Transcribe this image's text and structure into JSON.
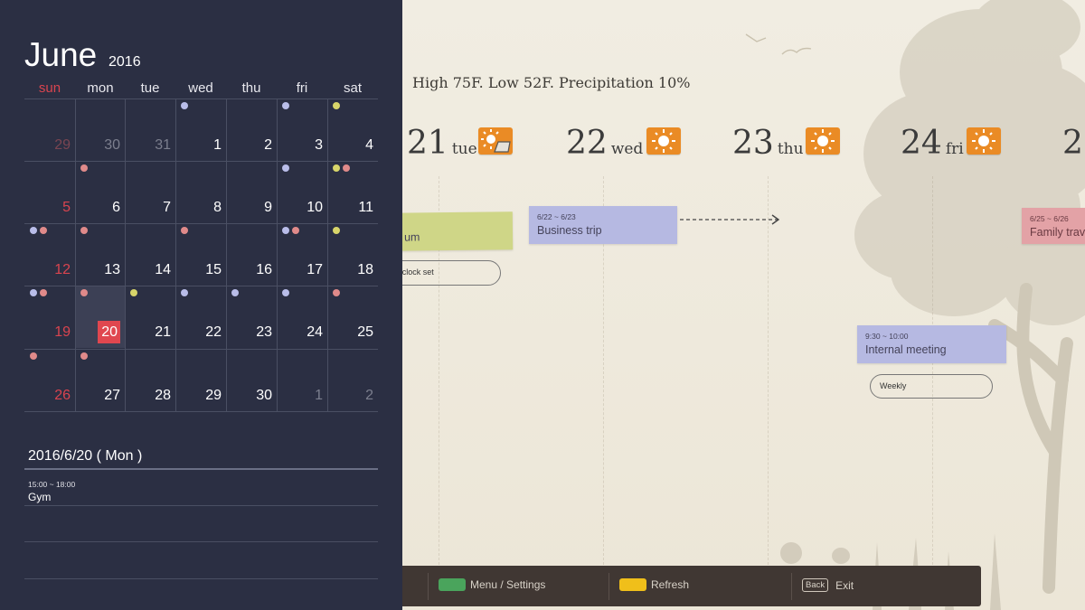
{
  "calendar": {
    "month": "June",
    "year": "2016",
    "weekdays": [
      "sun",
      "mon",
      "tue",
      "wed",
      "thu",
      "fri",
      "sat"
    ],
    "weeks": [
      [
        {
          "d": "29",
          "c": "dimred"
        },
        {
          "d": "30",
          "c": "dim"
        },
        {
          "d": "31",
          "c": "dim"
        },
        {
          "d": "1",
          "c": "",
          "dots": [
            "#b9bde9"
          ]
        },
        {
          "d": "2",
          "c": ""
        },
        {
          "d": "3",
          "c": "",
          "dots": [
            "#b9bde9"
          ]
        },
        {
          "d": "4",
          "c": "",
          "dots": [
            "#d8d56a"
          ]
        }
      ],
      [
        {
          "d": "5",
          "c": "red"
        },
        {
          "d": "6",
          "c": "",
          "dots": [
            "#e08a8a"
          ]
        },
        {
          "d": "7",
          "c": ""
        },
        {
          "d": "8",
          "c": ""
        },
        {
          "d": "9",
          "c": ""
        },
        {
          "d": "10",
          "c": "",
          "dots": [
            "#b9bde9"
          ]
        },
        {
          "d": "11",
          "c": "",
          "dots": [
            "#d8d56a",
            "#e08a8a"
          ]
        }
      ],
      [
        {
          "d": "12",
          "c": "red",
          "dots": [
            "#b9bde9",
            "#e08a8a"
          ]
        },
        {
          "d": "13",
          "c": "",
          "dots": [
            "#e08a8a"
          ]
        },
        {
          "d": "14",
          "c": ""
        },
        {
          "d": "15",
          "c": "",
          "dots": [
            "#e08a8a"
          ]
        },
        {
          "d": "16",
          "c": ""
        },
        {
          "d": "17",
          "c": "",
          "dots": [
            "#b9bde9",
            "#e08a8a"
          ]
        },
        {
          "d": "18",
          "c": "",
          "dots": [
            "#d8d56a"
          ]
        }
      ],
      [
        {
          "d": "19",
          "c": "red",
          "dots": [
            "#b9bde9",
            "#e08a8a"
          ]
        },
        {
          "d": "20",
          "c": "today",
          "dots": [
            "#e08a8a"
          ]
        },
        {
          "d": "21",
          "c": "",
          "dots": [
            "#d8d56a"
          ]
        },
        {
          "d": "22",
          "c": "",
          "dots": [
            "#b9bde9"
          ]
        },
        {
          "d": "23",
          "c": "",
          "dots": [
            "#b9bde9"
          ]
        },
        {
          "d": "24",
          "c": "",
          "dots": [
            "#b9bde9"
          ]
        },
        {
          "d": "25",
          "c": "",
          "dots": [
            "#e08a8a"
          ]
        }
      ],
      [
        {
          "d": "26",
          "c": "red",
          "dots": [
            "#e08a8a"
          ]
        },
        {
          "d": "27",
          "c": "",
          "dots": [
            "#e08a8a"
          ]
        },
        {
          "d": "28",
          "c": ""
        },
        {
          "d": "29",
          "c": ""
        },
        {
          "d": "30",
          "c": ""
        },
        {
          "d": "1",
          "c": "dim"
        },
        {
          "d": "2",
          "c": "dim"
        }
      ]
    ],
    "selected_date": "2016/6/20 ( Mon )",
    "events": [
      {
        "time": "15:00 ~ 18:00",
        "name": "Gym"
      }
    ]
  },
  "weather": {
    "summary": "High 75F. Low 52F. Precipitation 10%"
  },
  "days": [
    {
      "num": "21",
      "name": "tue",
      "icon": "sun-cloud-icon"
    },
    {
      "num": "22",
      "name": "wed",
      "icon": "sun-icon"
    },
    {
      "num": "23",
      "name": "thu",
      "icon": "sun-icon"
    },
    {
      "num": "24",
      "name": "fri",
      "icon": "sun-icon"
    },
    {
      "num": "2",
      "name": "",
      "icon": ""
    }
  ],
  "notes": {
    "museum": {
      "label": "um",
      "bubble": "'clock set",
      "color": "#cfd687"
    },
    "business_trip": {
      "range": "6/22 ~ 6/23",
      "label": "Business trip",
      "color": "#b6b9e2"
    },
    "internal_meeting": {
      "time": "9:30 ~ 10:00",
      "label": "Internal meeting",
      "bubble": "Weekly",
      "color": "#b6b9e2"
    },
    "family_travel": {
      "range": "6/25 ~ 6/26",
      "label": "Family trav",
      "color": "#e3a2a6"
    }
  },
  "bottom_bar": {
    "menu_label": "Menu / Settings",
    "menu_color": "#4aa45c",
    "refresh_label": "Refresh",
    "refresh_color": "#f0bf1a",
    "back_key": "Back",
    "exit_label": "Exit"
  }
}
